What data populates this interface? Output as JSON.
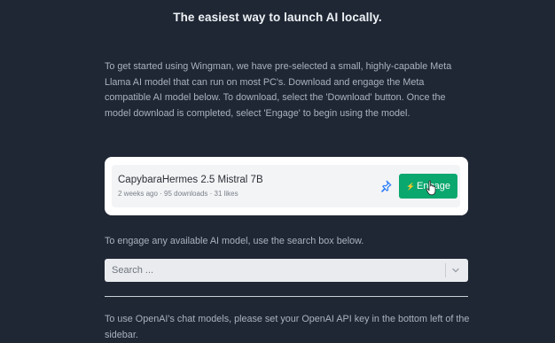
{
  "header": {
    "title": "The easiest way to launch AI locally."
  },
  "intro": {
    "text": "To get started using Wingman, we have pre-selected a small, highly-capable Meta Llama AI model that can run on most PC's. Download and engage the Meta compatible AI model below. To download, select the 'Download' button. Once the model download is completed, select 'Engage' to begin using the model."
  },
  "model_card": {
    "name": "CapybaraHermes 2.5 Mistral 7B",
    "meta": "2 weeks ago · 95 downloads · 31 likes",
    "pin_icon": "pin-icon",
    "engage_icon": "bolt-icon",
    "engage_label": "Engage"
  },
  "engage_note": "To engage any available AI model, use the search box below.",
  "search": {
    "placeholder": "Search ...",
    "value": "",
    "dropdown_icon": "chevron-down-icon"
  },
  "openai_note": "To use OpenAI's chat models, please set your OpenAI API key in the bottom left of the sidebar.",
  "colors": {
    "background": "#1f2734",
    "engage_button": "#0aa86f",
    "pin_icon": "#2d7ff9"
  }
}
